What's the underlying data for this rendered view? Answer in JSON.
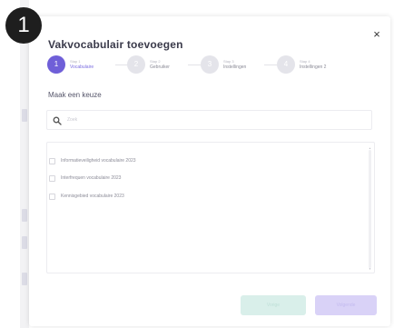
{
  "annotation": {
    "badge_number": "1"
  },
  "modal": {
    "title": "Vakvocabulair toevoegen",
    "close_label": "×"
  },
  "stepper": {
    "steps": [
      {
        "num": "Stap 1",
        "name": "Vocabulaire",
        "index": "1",
        "active": true
      },
      {
        "num": "Stap 2",
        "name": "Gebruiker",
        "index": "2",
        "active": false
      },
      {
        "num": "Stap 3",
        "name": "Instellingen",
        "index": "3",
        "active": false
      },
      {
        "num": "Stap 4",
        "name": "Instellingen 2",
        "index": "4",
        "active": false
      }
    ]
  },
  "choice": {
    "label": "Maak een keuze"
  },
  "search": {
    "placeholder": "Zoek",
    "icon": "search-icon"
  },
  "list": {
    "items": [
      {
        "label": "Informatieveiligheid vocabulaire 2023"
      },
      {
        "label": "Interfrequen vocabulaire 2023"
      },
      {
        "label": "Kennisgebied vocabulaire 2023"
      }
    ]
  },
  "buttons": {
    "back_label": "Vorige",
    "next_label": "Volgende"
  },
  "colors": {
    "accent": "#6f5fd8",
    "back_button": "#d9efea",
    "next_button": "#d9d2f7",
    "badge": "#1e1e1e"
  }
}
